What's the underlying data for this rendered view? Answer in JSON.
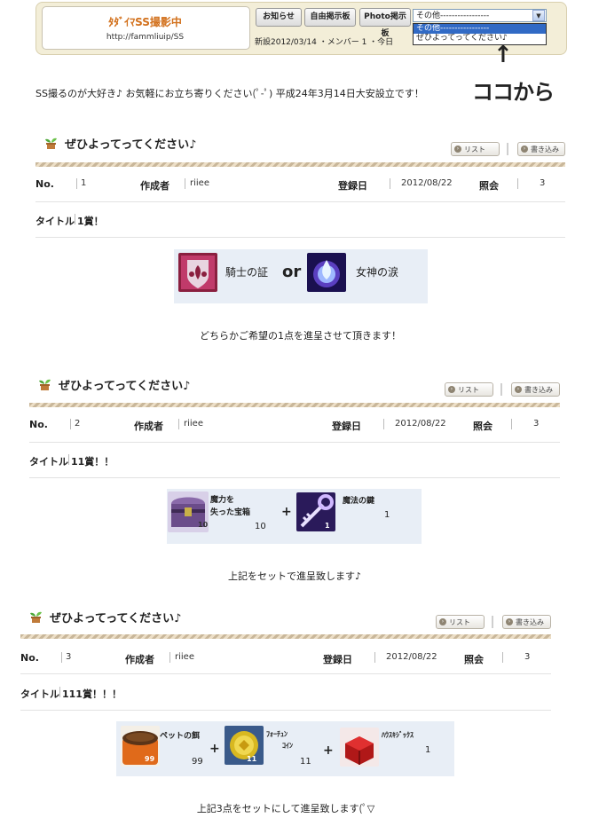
{
  "header": {
    "club_title": "ﾀﾀﾞｲﾏSS撮影中",
    "club_url": "http://fammliuip/SS",
    "buttons": [
      "お知らせ",
      "自由掲示板",
      "Photo掲示板"
    ],
    "meta": "新設2012/03/14 ・メンバー 1 ・今日",
    "select_value": "その他-----------------",
    "dropdown_options": [
      "その他-----------------",
      "ぜひよってってください♪"
    ],
    "annotation_arrow": "↑",
    "annotation_text": "ココから"
  },
  "intro": "SS撮るのが大好き♪ お気軽にお立ち寄りください(ﾟ-ﾟ) 平成24年3月14日大安設立です！",
  "labels": {
    "list": "リスト",
    "write": "書き込み",
    "no": "No.",
    "author": "作成者",
    "date": "登録日",
    "views": "照会",
    "title": "タイトル"
  },
  "posts": [
    {
      "heading": "ぜひよってってください♪",
      "no": "1",
      "author": "riiee",
      "date": "2012/08/22",
      "views": "3",
      "title": "1賞！",
      "item1": "騎士の証",
      "or": "or",
      "item2": "女神の涙",
      "caption": "どちらかご希望の1点を進呈させて頂きます！"
    },
    {
      "heading": "ぜひよってってください♪",
      "no": "2",
      "author": "riiee",
      "date": "2012/08/22",
      "views": "3",
      "title": "11賞！！",
      "item1_line1": "魔力を",
      "item1_line2": "失った宝箱",
      "item1_badge": "10",
      "item1_qty": "10",
      "item2": "魔法の鍵",
      "item2_badge": "1",
      "item2_qty": "1",
      "plus": "+",
      "caption": "上記をセットで進呈致します♪"
    },
    {
      "heading": "ぜひよってってください♪",
      "no": "3",
      "author": "riiee",
      "date": "2012/08/22",
      "views": "3",
      "title": "111賞！！！",
      "item1": "ペットの餌",
      "item1_badge": "99",
      "item1_qty": "99",
      "item2_line1": "ﾌｫｰﾁｭﾝ",
      "item2_line2": "ｺｲﾝ",
      "item2_badge": "11",
      "item2_qty": "11",
      "item3": "ﾊｳｽｷｼﾞｯｸｽ",
      "item3_qty": "1",
      "plus": "+",
      "caption": "上記3点をセットにして進呈致します(ﾟ▽"
    }
  ]
}
